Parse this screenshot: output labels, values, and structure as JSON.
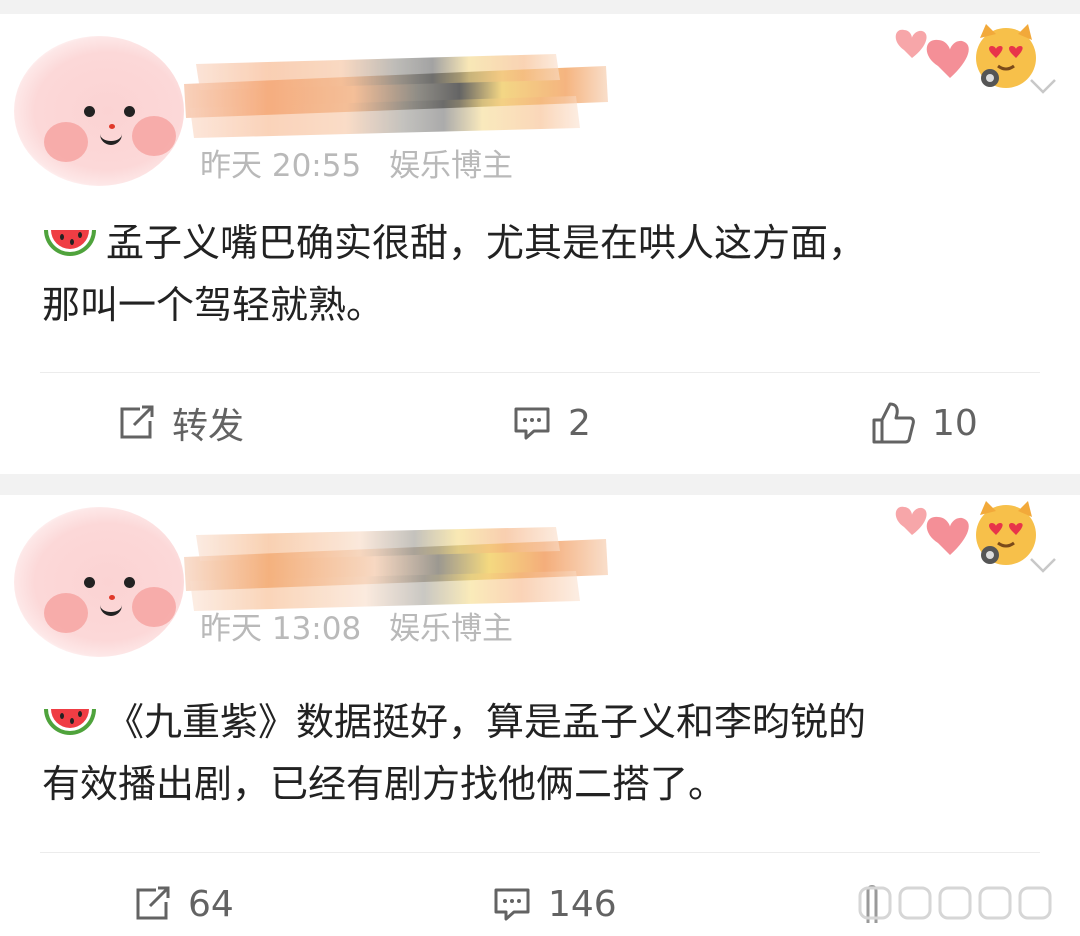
{
  "posts": [
    {
      "time": "昨天 20:55",
      "source": "娱乐博主",
      "content_lines": [
        "孟子义嘴巴确实很甜，尤其是在哄人这方面，",
        "那叫一个驾轻就熟。"
      ],
      "actions": {
        "repost": "转发",
        "comments": "2",
        "likes": "10"
      }
    },
    {
      "time": "昨天 13:08",
      "source": "娱乐博主",
      "content_lines": [
        "《九重紫》数据挺好，算是孟子义和李昀锐的",
        "有效播出剧，已经有剧方找他俩二搭了。"
      ],
      "actions": {
        "repost": "64",
        "comments": "146",
        "likes": ""
      }
    }
  ],
  "icons": {
    "avatar": "pink-blush-face-avatar",
    "name_redaction": "colored-scribble-redaction",
    "badge": "heart-eyes-cat-badge",
    "menu": "chevron-down-icon",
    "content_emoji": "watermelon-emoji",
    "repost": "repost-icon",
    "comment": "comment-icon",
    "like": "thumbs-up-icon"
  },
  "colors": {
    "background": "#f2f2f2",
    "card": "#ffffff",
    "text": "#222222",
    "meta": "#b9b9b9",
    "action": "#636363"
  }
}
